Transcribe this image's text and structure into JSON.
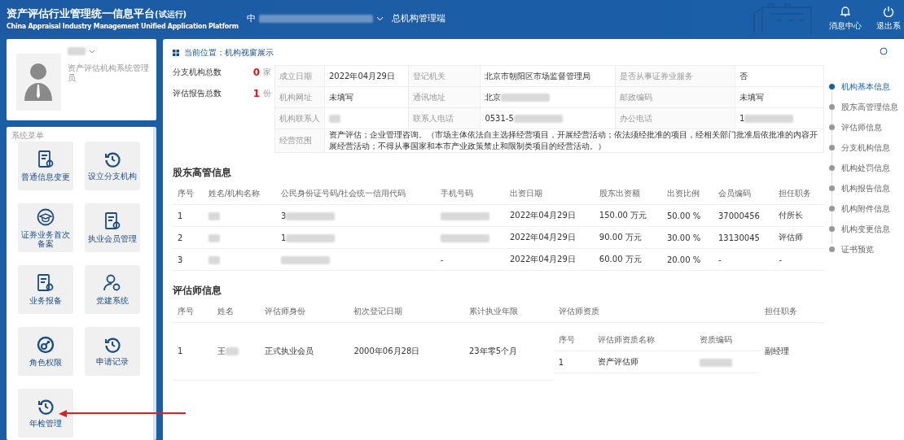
{
  "header": {
    "title": "资产评估行业管理统一信息平台",
    "title_badge": "(试运行)",
    "subtitle": "China Appraisal Industry Management Unified  Application  Platform",
    "org_name": "中",
    "portal": "总机构管理端",
    "actions": [
      {
        "kind": "bell",
        "label": "消息中心"
      },
      {
        "kind": "power",
        "label": "退出系"
      }
    ]
  },
  "profile": {
    "role": "资产评估机构系统管理员"
  },
  "menu": {
    "title": "系统菜单",
    "items": [
      {
        "kind": "doc",
        "label": "普通信息变更"
      },
      {
        "kind": "history",
        "label": "设立分支机构"
      },
      {
        "kind": "cap",
        "label": "证券业务首次备案"
      },
      {
        "kind": "doc",
        "label": "执业会员管理"
      },
      {
        "kind": "docgear",
        "label": "业务报备"
      },
      {
        "kind": "usergear",
        "label": "党建系统"
      },
      {
        "kind": "key",
        "label": "角色权限"
      },
      {
        "kind": "history",
        "label": "申请记录"
      },
      {
        "kind": "history",
        "label": "年检管理"
      }
    ]
  },
  "breadcrumb": "当前位置：机构视窗展示",
  "stats": [
    {
      "label": "分支机构总数",
      "value": "0",
      "unit": "家"
    },
    {
      "label": "评估报告总数",
      "value": "1",
      "unit": "份"
    }
  ],
  "basic_info": [
    [
      {
        "label": "成立日期",
        "value": "2022年04月29日"
      },
      {
        "label": "登记机关",
        "value": "北京市朝阳区市场监督管理局"
      },
      {
        "label": "是否从事证券业服务",
        "value": "否"
      }
    ],
    [
      {
        "label": "机构网址",
        "value": "未填写"
      },
      {
        "label": "通讯地址",
        "value": "北京",
        "redacted": true
      },
      {
        "label": "邮政编码",
        "value": "未填写"
      }
    ],
    [
      {
        "label": "机构联系人",
        "redacted": true
      },
      {
        "label": "联系人电话",
        "value": "0531-5",
        "redacted": true
      },
      {
        "label": "办公电话",
        "value": "1",
        "redacted": true
      }
    ],
    [
      {
        "label": "经营范围",
        "value": "资产评估；企业管理咨询。（市场主体依法自主选择经营项目，开展经营活动；依法须经批准的项目，经相关部门批准后依批准的内容开展经营活动；不得从事国家和本市产业政策禁止和限制类项目的经营活动。）"
      }
    ]
  ],
  "shareholders": {
    "title": "股东高管信息",
    "columns": [
      "序号",
      "姓名/机构名称",
      "公民身份证号码/社会统一信用代码",
      "手机号码",
      "出资日期",
      "股东出资额",
      "出资比例",
      "会员编码",
      "担任职务"
    ],
    "rows": [
      [
        {
          "text": "1"
        },
        {
          "redacted": true
        },
        {
          "text": "3",
          "redacted": true
        },
        {
          "redacted": true
        },
        {
          "text": "2022年04月29日"
        },
        {
          "text": "150.00 万元"
        },
        {
          "text": "50.00 %"
        },
        {
          "text": "37000456"
        },
        {
          "text": "付所长"
        }
      ],
      [
        {
          "text": "2"
        },
        {
          "redacted": true
        },
        {
          "text": "1",
          "redacted": true
        },
        {
          "redacted": true
        },
        {
          "text": "2022年04月29日"
        },
        {
          "text": "90.00 万元"
        },
        {
          "text": "30.00 %"
        },
        {
          "text": "13130045"
        },
        {
          "text": "评估师"
        }
      ],
      [
        {
          "text": "3"
        },
        {
          "redacted": true
        },
        {
          "redacted": true
        },
        {
          "text": "-"
        },
        {
          "text": "2022年04月29日"
        },
        {
          "text": "60.00 万元"
        },
        {
          "text": "20.00 %"
        },
        {
          "text": "-"
        },
        {
          "text": "-"
        }
      ]
    ]
  },
  "appraisers": {
    "title": "评估师信息",
    "columns": [
      "序号",
      "姓名",
      "评估师身份",
      "初次登记日期",
      "累计执业年限",
      "评估师资质",
      "担任职务"
    ],
    "rows": [
      {
        "index": "1",
        "name": {
          "text": "王",
          "redacted": true
        },
        "identity": "正式执业会员",
        "date": "2000年06月28日",
        "years": "23年零5个月",
        "role": "副经理",
        "qualification": {
          "columns": [
            "序号",
            "评估师资质名称",
            "资质编码"
          ],
          "rows": [
            [
              {
                "text": "1"
              },
              {
                "text": "资产评估师"
              },
              {
                "redacted": true
              }
            ]
          ]
        }
      }
    ]
  },
  "nav": [
    {
      "label": "机构基本信息",
      "selected": true
    },
    {
      "label": "股东高管理信息",
      "selected": false
    },
    {
      "label": "评估师信息",
      "selected": false
    },
    {
      "label": "分支机构信息",
      "selected": false
    },
    {
      "label": "机构处罚信息",
      "selected": false
    },
    {
      "label": "机构报告信息",
      "selected": false
    },
    {
      "label": "机构附件信息",
      "selected": false
    },
    {
      "label": "机构变更信息",
      "selected": false
    },
    {
      "label": "证书预览",
      "selected": false
    }
  ]
}
